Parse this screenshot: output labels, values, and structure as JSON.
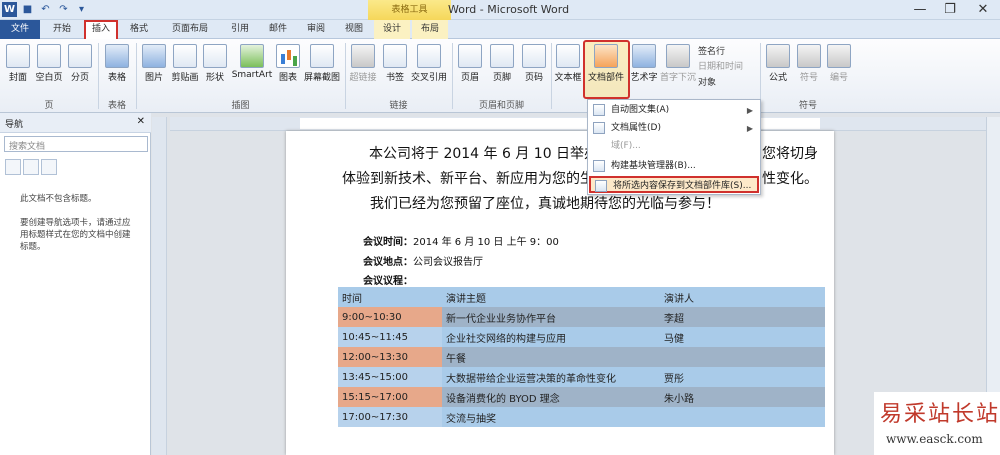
{
  "window": {
    "title": "Word  -  Microsoft Word",
    "contextual_tab_title": "表格工具",
    "minimize": "—",
    "restore": "❐",
    "close": "✕"
  },
  "qat": {
    "logo": "W",
    "save": "■",
    "undo": "↶",
    "redo": "↷",
    "customize": "▾"
  },
  "tabs": [
    "文件",
    "开始",
    "插入",
    "格式",
    "页面布局",
    "引用",
    "邮件",
    "审阅",
    "视图",
    "设计",
    "布局"
  ],
  "ribbon": {
    "buttons": [
      "封面",
      "空白页",
      "分页",
      "表格",
      "图片",
      "剪贴画",
      "形状",
      "SmartArt",
      "图表",
      "屏幕截图",
      "超链接",
      "书签",
      "交叉引用",
      "页眉",
      "页脚",
      "页码",
      "文本框",
      "文档部件",
      "艺术字",
      "首字下沉",
      "公式",
      "符号",
      "编号"
    ],
    "small": [
      "签名行",
      "日期和时间",
      "对象"
    ],
    "groups": [
      "页",
      "表格",
      "插图",
      "链接",
      "页眉和页脚",
      "符号"
    ]
  },
  "nav": {
    "title": "导航",
    "search_placeholder": "搜索文档",
    "msg1": "此文档不包含标题。",
    "msg2": "要创建导航选项卡，请通过应用标题样式在您的文档中创建标题。"
  },
  "doc": {
    "line1": "本公司将于 2014 年 6 月 10 日举办",
    "line1_tail": "您将切身",
    "line2": "体验到新技术、新平台、新应用为您的生",
    "line2_tail": "性变化。",
    "line3": "我们已经为您预留了座位，真诚地期待您的光临与参与！",
    "time_label": "会议时间：",
    "time_value": "2014 年 6 月 10 日 上午 9：00",
    "place_label": "会议地点：",
    "place_value": "公司会议报告厅",
    "agenda_label": "会议议程：",
    "table": {
      "headers": [
        "时间",
        "演讲主题",
        "演讲人"
      ],
      "rows": [
        [
          "9:00~10:30",
          "新一代企业业务协作平台",
          "李超"
        ],
        [
          "10:45~11:45",
          "企业社交网络的构建与应用",
          "马健"
        ],
        [
          "12:00~13:30",
          "午餐",
          ""
        ],
        [
          "13:45~15:00",
          "大数据带给企业运营决策的革命性变化",
          "贾彤"
        ],
        [
          "15:15~17:00",
          "设备消费化的 BYOD 理念",
          "朱小路"
        ],
        [
          "17:00~17:30",
          "交流与抽奖",
          ""
        ]
      ]
    }
  },
  "menu": {
    "items": [
      "自动图文集(A)",
      "文档属性(D)",
      "域(F)...",
      "构建基块管理器(B)...",
      "将所选内容保存到文档部件库(S)..."
    ]
  },
  "watermark": {
    "name": "易采站长站",
    "url": "www.easck.com"
  },
  "colors": {
    "accent": "#2b579a",
    "highlight_red": "#d0312d"
  }
}
